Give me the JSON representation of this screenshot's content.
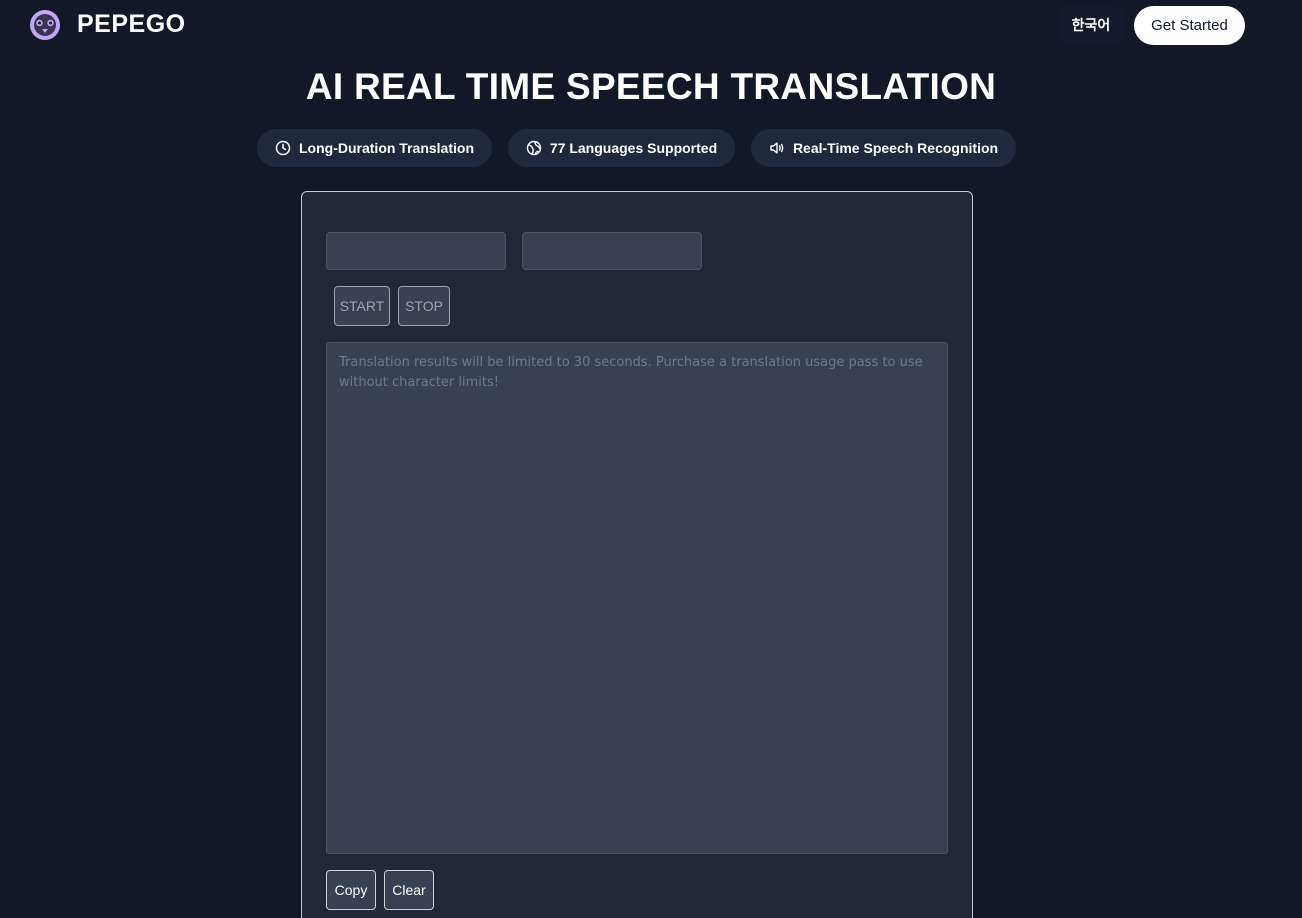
{
  "header": {
    "brand": "PEPEGO",
    "logo_icon": "owl-logo-icon",
    "language_label": "한국어",
    "cta_label": "Get Started"
  },
  "hero": {
    "title": "AI REAL TIME SPEECH TRANSLATION"
  },
  "features": [
    {
      "icon": "clock-icon",
      "label": "Long-Duration Translation"
    },
    {
      "icon": "globe-icon",
      "label": "77 Languages Supported"
    },
    {
      "icon": "speaker-icon",
      "label": "Real-Time Speech Recognition"
    }
  ],
  "translator": {
    "source_language": "",
    "target_language": "",
    "start_label": "START",
    "stop_label": "STOP",
    "result_placeholder": "Translation results will be limited to 30 seconds. Purchase a translation usage pass to use without character limits!",
    "copy_label": "Copy",
    "clear_label": "Clear"
  },
  "colors": {
    "background": "#111827",
    "card": "#1f2937",
    "input": "#374151",
    "pill": "#1e293b",
    "logo_accent": "#c4a5f5"
  }
}
